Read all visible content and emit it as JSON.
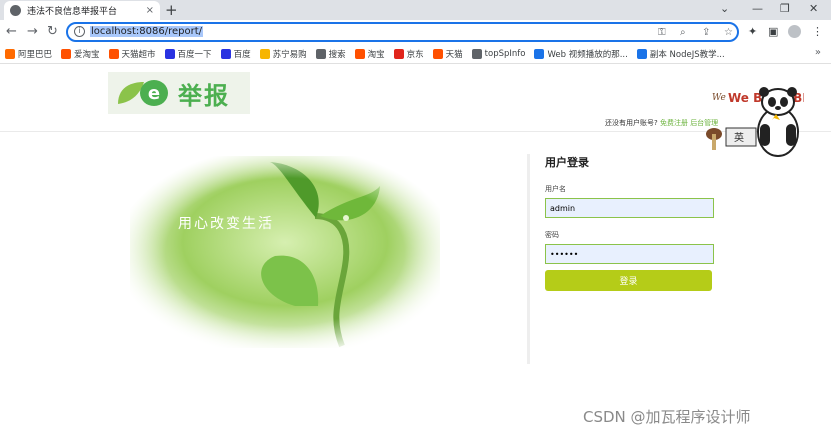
{
  "browser": {
    "tab_title": "违法不良信息举报平台",
    "tab_close": "×",
    "new_tab": "+",
    "window_controls": [
      "⌄",
      "—",
      "❐",
      "✕"
    ],
    "nav": {
      "back": "←",
      "forward": "→",
      "reload": "↻"
    },
    "url": "localhost:8086/report/",
    "omnibox_icons": [
      "key-icon",
      "zoom-icon",
      "share-icon",
      "star-icon"
    ],
    "toolbar_icons": [
      "extensions-icon",
      "sidepanel-icon",
      "profile-icon",
      "menu-icon"
    ],
    "bookmarks": [
      {
        "label": "阿里巴巴",
        "color": "#ff6a00"
      },
      {
        "label": "爱淘宝",
        "color": "#ff5000"
      },
      {
        "label": "天猫超市",
        "color": "#ff5000"
      },
      {
        "label": "百度一下",
        "color": "#2932e1"
      },
      {
        "label": "百度",
        "color": "#2932e1"
      },
      {
        "label": "苏宁易购",
        "color": "#f7b500"
      },
      {
        "label": "搜索",
        "color": "#5f6368"
      },
      {
        "label": "淘宝",
        "color": "#ff5000"
      },
      {
        "label": "京东",
        "color": "#e1251b"
      },
      {
        "label": "天猫",
        "color": "#ff5000"
      },
      {
        "label": "topSpInfo",
        "color": "#5f6368"
      },
      {
        "label": "Web 视频播放的那...",
        "color": "#1a73e8"
      },
      {
        "label": "副本 NodeJS教学...",
        "color": "#1a73e8"
      }
    ],
    "bookmarks_more": "»"
  },
  "page": {
    "logo_text": "举报",
    "logo_letter": "e",
    "register_prompt": "还没有用户账号?",
    "register_link": "免费注册",
    "admin_link": "后台管理",
    "banner_text": "用心改变生活",
    "login": {
      "title": "用户登录",
      "username_label": "用户名",
      "username_value": "admin",
      "password_label": "密码",
      "password_value": "••••••",
      "submit": "登录"
    },
    "accent_color": "#b5cc18",
    "mascot_text": "We BARE BEARS",
    "mascot_sign": "英"
  },
  "watermark": "CSDN @加瓦程序设计师"
}
